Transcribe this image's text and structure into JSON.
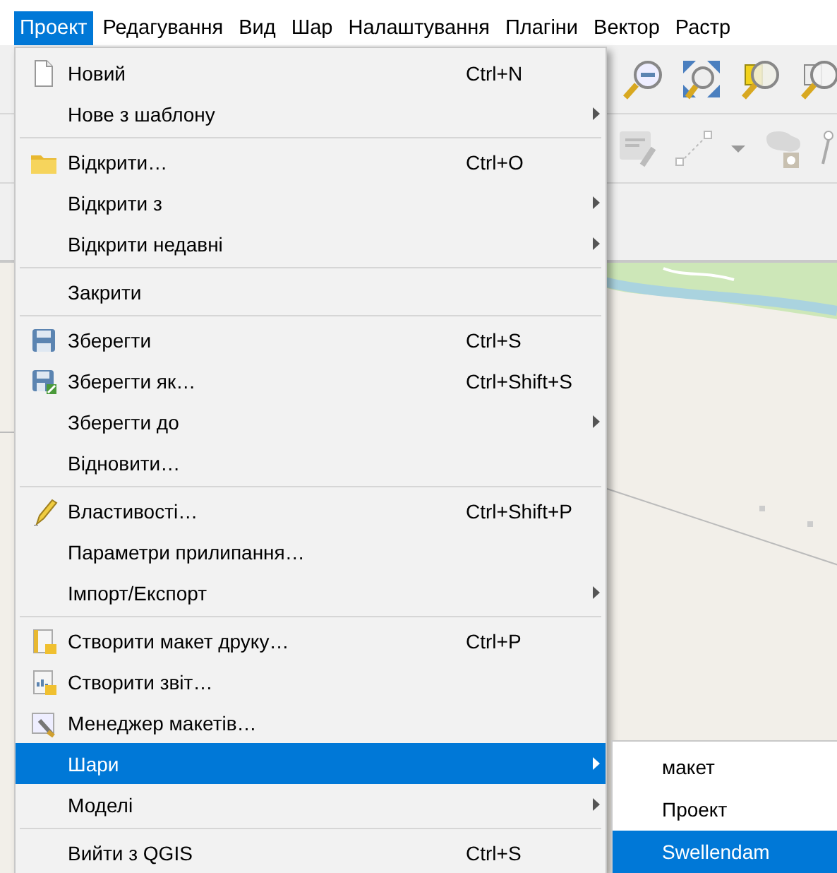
{
  "menubar": {
    "items": [
      {
        "label": "Проект",
        "selected": true
      },
      {
        "label": "Редагування",
        "selected": false
      },
      {
        "label": "Вид",
        "selected": false
      },
      {
        "label": "Шар",
        "selected": false
      },
      {
        "label": "Налаштування",
        "selected": false
      },
      {
        "label": "Плагіни",
        "selected": false
      },
      {
        "label": "Вектор",
        "selected": false
      },
      {
        "label": "Растр",
        "selected": false
      }
    ]
  },
  "menu": {
    "groups": [
      {
        "items": [
          {
            "label": "Новий",
            "shortcut": "Ctrl+N",
            "submenu": false,
            "selected": false
          },
          {
            "label": "Нове з шаблону",
            "submenu": true,
            "selected": false
          }
        ]
      },
      {
        "items": [
          {
            "label": "Відкрити…",
            "shortcut": "Ctrl+O",
            "submenu": false,
            "selected": false
          },
          {
            "label": "Відкрити з",
            "submenu": true,
            "selected": false
          },
          {
            "label": "Відкрити недавні",
            "submenu": true,
            "selected": false
          }
        ]
      },
      {
        "items": [
          {
            "label": "Закрити",
            "submenu": false,
            "selected": false
          }
        ]
      },
      {
        "items": [
          {
            "label": "Зберегти",
            "shortcut": "Ctrl+S",
            "submenu": false,
            "selected": false
          },
          {
            "label": "Зберегти як…",
            "shortcut": "Ctrl+Shift+S",
            "submenu": false,
            "selected": false
          },
          {
            "label": "Зберегти до",
            "submenu": true,
            "selected": false
          },
          {
            "label": "Відновити…",
            "submenu": false,
            "selected": false
          }
        ]
      },
      {
        "items": [
          {
            "label": "Властивості…",
            "shortcut": "Ctrl+Shift+P",
            "submenu": false,
            "selected": false
          },
          {
            "label": "Параметри прилипання…",
            "submenu": false,
            "selected": false
          },
          {
            "label": "Імпорт/Експорт",
            "submenu": true,
            "selected": false
          }
        ]
      },
      {
        "items": [
          {
            "label": "Створити макет друку…",
            "shortcut": "Ctrl+P",
            "submenu": false,
            "selected": false
          },
          {
            "label": "Створити звіт…",
            "submenu": false,
            "selected": false
          },
          {
            "label": "Менеджер макетів…",
            "submenu": false,
            "selected": false
          },
          {
            "label": "Шари",
            "submenu": true,
            "selected": true
          },
          {
            "label": "Моделі",
            "submenu": true,
            "selected": false
          }
        ]
      },
      {
        "items": [
          {
            "label": "Вийти з QGIS",
            "shortcut": "Ctrl+S",
            "submenu": false,
            "selected": false
          }
        ]
      }
    ]
  },
  "submenu": {
    "items": [
      {
        "label": "макет",
        "selected": false
      },
      {
        "label": "Проект",
        "selected": false
      },
      {
        "label": "Swellendam",
        "selected": true
      }
    ]
  }
}
